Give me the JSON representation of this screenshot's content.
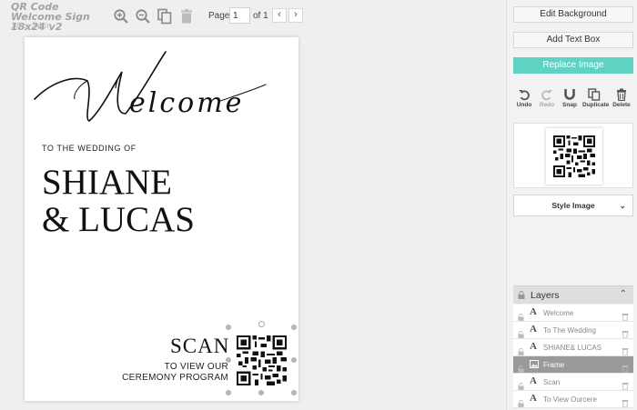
{
  "document": {
    "title": "QR Code Welcome Sign 18x24 v2",
    "size": "18 x 24 in"
  },
  "toolbar": {
    "tools": [
      "zoom-in-icon",
      "zoom-out-icon",
      "copy-icon",
      "trash-icon"
    ],
    "page_label": "Page",
    "page_value": "1",
    "page_of": "of 1",
    "prev": "‹",
    "next": "›"
  },
  "canvas": {
    "script_title": "Welcome",
    "to_wedding": "TO THE WEDDING OF",
    "names_line1": "SHIANE",
    "names_line2": "& LUCAS",
    "scan": "SCAN",
    "view_line1": "TO VIEW OUR",
    "view_line2": "CEREMONY PROGRAM"
  },
  "sidebar": {
    "edit_background": "Edit Background",
    "add_text_box": "Add Text Box",
    "replace_image": "Replace Image",
    "actions": [
      {
        "label": "Undo",
        "icon": "undo-icon",
        "enabled": true
      },
      {
        "label": "Redo",
        "icon": "redo-icon",
        "enabled": false
      },
      {
        "label": "Snap",
        "icon": "magnet-icon",
        "enabled": true
      },
      {
        "label": "Duplicate",
        "icon": "duplicate-icon",
        "enabled": true
      },
      {
        "label": "Delete",
        "icon": "trash-icon",
        "enabled": true
      }
    ],
    "style_image": "Style Image",
    "layers_title": "Layers",
    "layers": [
      {
        "type": "text",
        "name": "Welcome",
        "active": false
      },
      {
        "type": "text",
        "name": "To The Wedding",
        "active": false
      },
      {
        "type": "text",
        "name": "SHIANE& LUCAS",
        "active": false
      },
      {
        "type": "image",
        "name": "Frame",
        "active": true
      },
      {
        "type": "text",
        "name": "Scan",
        "active": false
      },
      {
        "type": "text",
        "name": "To View Ourcere",
        "active": false
      }
    ]
  },
  "colors": {
    "accent": "#5ed3c3",
    "active_layer": "#9a9a9a",
    "background": "#efefef"
  }
}
